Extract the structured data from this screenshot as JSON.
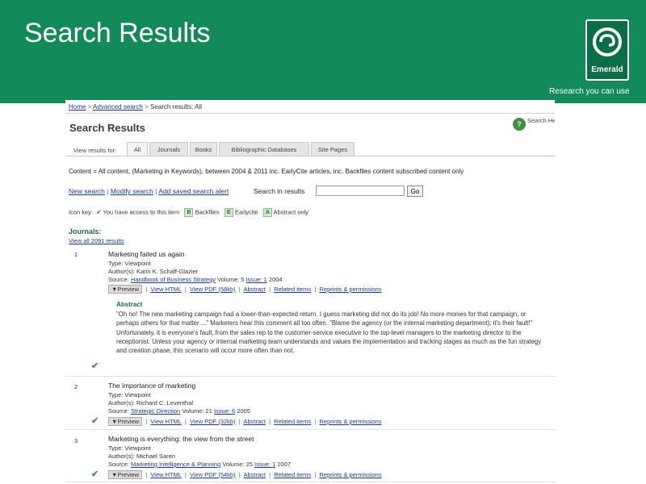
{
  "slide": {
    "title": "Search Results",
    "logo_text": "Emerald",
    "tagline": "Research you can use",
    "colors": {
      "band": "#138a5a",
      "logo_bg": "#0a6e47",
      "link": "#1a3a9a",
      "heading_green": "#1a6b4a"
    }
  },
  "breadcrumb": {
    "home": "Home",
    "advanced": "Advanced search",
    "current": "Search results: All"
  },
  "page_title": "Search Results",
  "help": {
    "icon": "help-icon",
    "label": "Search Help"
  },
  "tabs": {
    "label": "View results for:",
    "items": [
      "All",
      "Journals",
      "Books",
      "Bibliographic Databases",
      "Site Pages"
    ]
  },
  "content_summary": "Content = All content, (Marketing in Keywords), between 2004 & 2011 inc. EarlyCite articles, inc. Backfiles content subscribed content only",
  "actions": {
    "new_search": "New search",
    "modify_search": "Modify search",
    "add_alert": "Add saved search alert",
    "search_in_results_label": "Search in results",
    "search_value": "",
    "go_label": "Go"
  },
  "icon_key": {
    "label": "Icon key:",
    "access_text": "You have access to this item",
    "backfiles_letter": "B",
    "backfiles_text": "Backfiles",
    "earlycite_letter": "E",
    "earlycite_text": "Earlycite",
    "abstract_letter": "A",
    "abstract_text": "Abstract only"
  },
  "journals": {
    "heading": "Journals:",
    "view_all": "View all 2091 results"
  },
  "results": [
    {
      "num": "1",
      "title": "Marketing failed us again",
      "type": "Type: Viewpoint",
      "authors": "Author(s): Karin K. Schaff-Glazier",
      "source_label": "Source:",
      "source_title": "Handbook of Business Strategy",
      "volume": "Volume: 5",
      "issue": "Issue: 1",
      "year": "2004",
      "preview": "▼Preview",
      "view_html": "View HTML",
      "view_pdf": "View PDF (58kb)",
      "abstract": "Abstract",
      "related": "Related items",
      "reprints": "Reprints & permissions"
    },
    {
      "num": "2",
      "title": "The importance of marketing",
      "type": "Type: Viewpoint",
      "authors": "Author(s): Richard C. Leventhal",
      "source_label": "Source:",
      "source_title": "Strategic Direction",
      "volume": "Volume: 21",
      "issue": "Issue: 6",
      "year": "2005",
      "preview": "▼Preview",
      "view_html": "View HTML",
      "view_pdf": "View PDF (32kb)",
      "abstract": "Abstract",
      "related": "Related items",
      "reprints": "Reprints & permissions"
    },
    {
      "num": "3",
      "title": "Marketing is everything: the view from the street",
      "type": "Type: Viewpoint",
      "authors": "Author(s): Michael Saren",
      "source_label": "Source:",
      "source_title": "Marketing Intelligence & Planning",
      "volume": "Volume: 25",
      "issue": "Issue: 1",
      "year": "2007",
      "preview": "▼Preview",
      "view_html": "View HTML",
      "view_pdf": "View PDF (54kb)",
      "abstract": "Abstract",
      "related": "Related items",
      "reprints": "Reprints & permissions"
    }
  ],
  "abstract_panel": {
    "heading": "Abstract",
    "text": "\"Oh no! The new marketing campaign had a lower-than-expected return. I guess marketing did not do its job! No more monies for that campaign, or perhaps others for that matter ...\" Marketers hear this comment all too often. \"Blame the agency (or the internal marketing department); it's their fault!\" Unfortunately, it is everyone's fault, from the sales rep to the customer-service executive to the top-level managers to the marketing director to the receptionist. Unless your agency or internal marketing team understands and values the implementation and tracking stages as much as the fun strategy and creation phase, this scenario will occur more often than not."
  }
}
